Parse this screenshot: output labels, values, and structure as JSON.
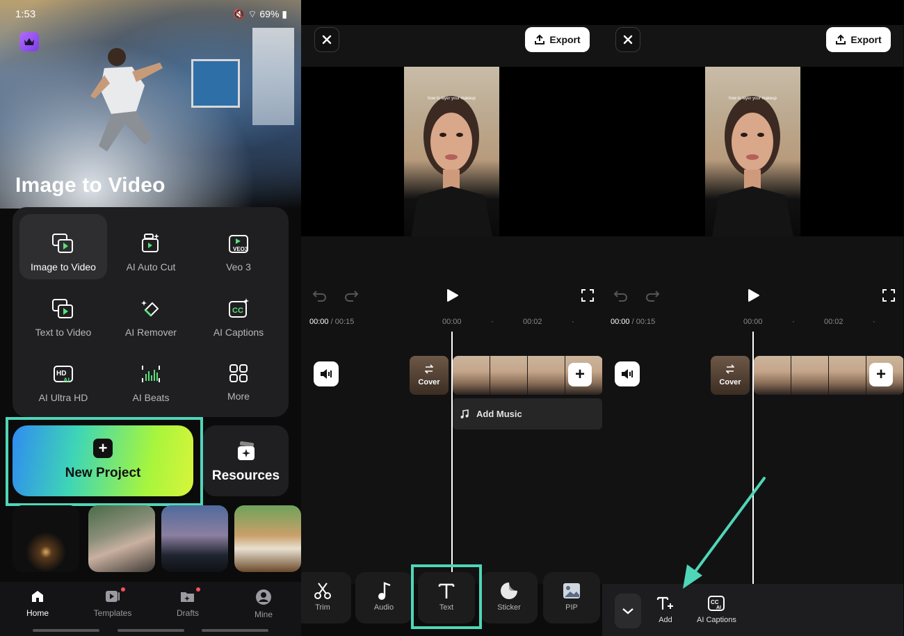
{
  "status_bar": {
    "time": "1:53",
    "battery": "69%"
  },
  "home": {
    "hero_title": "Image to Video",
    "tools": [
      {
        "label": "Image to Video",
        "icon": "image-to-video-icon"
      },
      {
        "label": "AI Auto Cut",
        "icon": "ai-auto-cut-icon"
      },
      {
        "label": "Veo 3",
        "icon": "veo3-icon"
      },
      {
        "label": "Text to Video",
        "icon": "text-to-video-icon"
      },
      {
        "label": "AI Remover",
        "icon": "ai-remover-icon"
      },
      {
        "label": "AI Captions",
        "icon": "ai-captions-icon"
      },
      {
        "label": "AI Ultra HD",
        "icon": "ai-ultra-hd-icon"
      },
      {
        "label": "AI Beats",
        "icon": "ai-beats-icon"
      },
      {
        "label": "More",
        "icon": "more-grid-icon"
      }
    ],
    "new_project_label": "New Project",
    "resources_label": "Resources",
    "bottom_nav": [
      {
        "label": "Home",
        "icon": "home-icon",
        "active": true
      },
      {
        "label": "Templates",
        "icon": "templates-icon",
        "badge": true
      },
      {
        "label": "Drafts",
        "icon": "drafts-icon",
        "badge": true
      },
      {
        "label": "Mine",
        "icon": "profile-icon"
      }
    ],
    "highlight_color": "#4fd6b8"
  },
  "editor": {
    "export_label": "Export",
    "time_current": "00:00",
    "time_total": "/ 00:15",
    "tick_0": "00:00",
    "tick_1": "00:02",
    "video_overlay_text": "how to layer your makeup",
    "cover_label": "Cover",
    "add_music_label": "Add Music",
    "toolbar": [
      {
        "label": "Trim",
        "icon": "scissors-icon"
      },
      {
        "label": "Audio",
        "icon": "music-note-icon"
      },
      {
        "label": "Text",
        "icon": "text-icon"
      },
      {
        "label": "Sticker",
        "icon": "sticker-icon"
      },
      {
        "label": "PIP",
        "icon": "pip-image-icon"
      }
    ]
  },
  "text_panel": {
    "items": [
      {
        "label": "Add",
        "icon": "add-text-icon"
      },
      {
        "label": "AI Captions",
        "icon": "ai-captions-icon"
      }
    ],
    "arrow_color": "#4fd6b8"
  }
}
